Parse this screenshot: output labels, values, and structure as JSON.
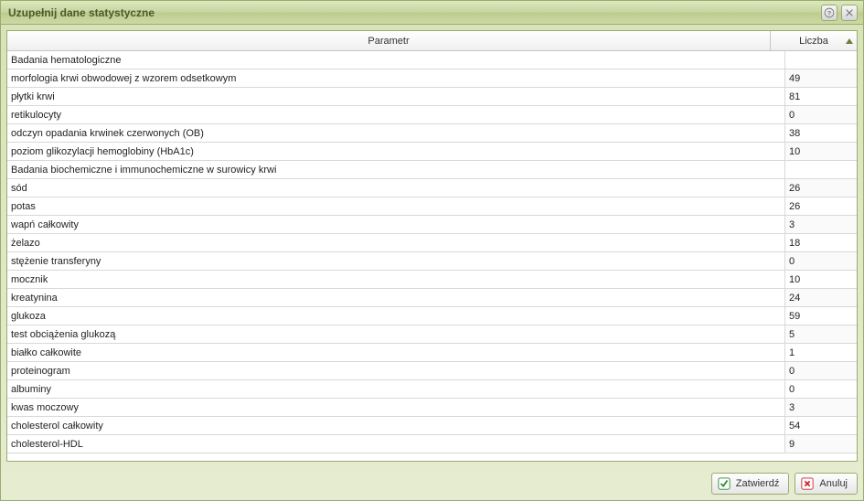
{
  "window": {
    "title": "Uzupełnij dane statystyczne"
  },
  "columns": {
    "param": "Parametr",
    "count": "Liczba"
  },
  "rows": [
    {
      "type": "section",
      "label": "Badania hematologiczne"
    },
    {
      "type": "data",
      "label": "morfologia krwi obwodowej z wzorem odsetkowym",
      "count": "49"
    },
    {
      "type": "data",
      "label": "płytki krwi",
      "count": "81"
    },
    {
      "type": "data",
      "label": "retikulocyty",
      "count": "0"
    },
    {
      "type": "data",
      "label": "odczyn opadania krwinek czerwonych (OB)",
      "count": "38"
    },
    {
      "type": "data",
      "label": "poziom glikozylacji hemoglobiny (HbA1c)",
      "count": "10"
    },
    {
      "type": "section",
      "label": "Badania biochemiczne i immunochemiczne w surowicy krwi"
    },
    {
      "type": "data",
      "label": "sód",
      "count": "26"
    },
    {
      "type": "data",
      "label": "potas",
      "count": "26"
    },
    {
      "type": "data",
      "label": "wapń całkowity",
      "count": "3"
    },
    {
      "type": "data",
      "label": "żelazo",
      "count": "18"
    },
    {
      "type": "data",
      "label": "stężenie transferyny",
      "count": "0"
    },
    {
      "type": "data",
      "label": "mocznik",
      "count": "10"
    },
    {
      "type": "data",
      "label": "kreatynina",
      "count": "24"
    },
    {
      "type": "data",
      "label": "glukoza",
      "count": "59"
    },
    {
      "type": "data",
      "label": "test obciążenia glukozą",
      "count": "5"
    },
    {
      "type": "data",
      "label": "białko całkowite",
      "count": "1"
    },
    {
      "type": "data",
      "label": "proteinogram",
      "count": "0"
    },
    {
      "type": "data",
      "label": "albuminy",
      "count": "0"
    },
    {
      "type": "data",
      "label": "kwas moczowy",
      "count": "3"
    },
    {
      "type": "data",
      "label": "cholesterol całkowity",
      "count": "54"
    },
    {
      "type": "data",
      "label": "cholesterol-HDL",
      "count": "9"
    }
  ],
  "buttons": {
    "confirm": "Zatwierdź",
    "cancel": "Anuluj"
  }
}
